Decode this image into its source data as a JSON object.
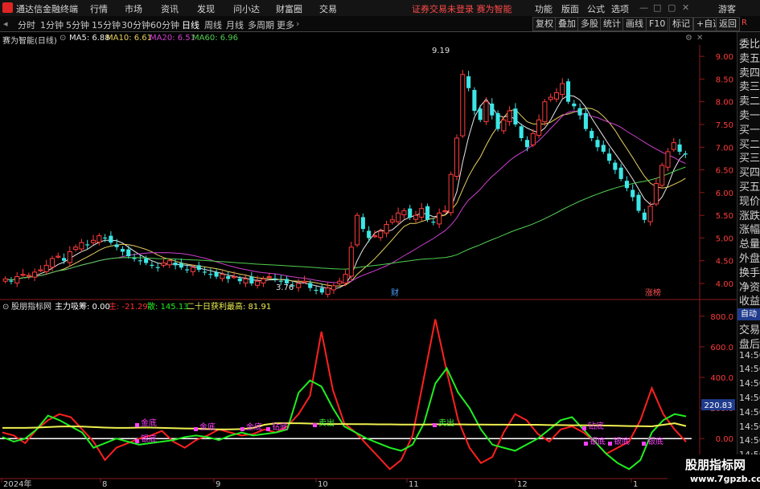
{
  "menubar": {
    "app_title": "通达信金融终端",
    "menus": [
      "行情",
      "市场",
      "资讯",
      "发现",
      "问小达",
      "财富圈",
      "交易"
    ],
    "alert": "证券交易未登录  赛为智能",
    "right": [
      "功能",
      "版面",
      "公式",
      "选项",
      "游客"
    ]
  },
  "periods": [
    "分时",
    "1分钟",
    "5分钟",
    "15分钟",
    "30分钟",
    "60分钟",
    "日线",
    "周线",
    "月线",
    "多周期",
    "更多"
  ],
  "active_period": "日线",
  "toolbar": [
    "复权",
    "叠加",
    "多股",
    "统计",
    "画线",
    "F10",
    "标记",
    "+自选",
    "返回"
  ],
  "main_info": {
    "name": "赛为智能(日线)",
    "ma5": "MA5: 6.88",
    "ma10": "MA10: 6.61",
    "ma20": "MA20: 6.51",
    "ma60": "MA60: 6.96"
  },
  "colors": {
    "bull": "#ff3c3c",
    "bear": "#3ce6e6",
    "ma5": "#e8e8e8",
    "ma10": "#e8d060",
    "ma20": "#d040d0",
    "ma60": "#50d050",
    "osc_red": "#ff2020",
    "osc_green": "#20ee20",
    "osc_yellow": "#f0f050",
    "label_magenta": "#ff40ff"
  },
  "price_axis": {
    "ticks": [
      "9.00",
      "8.50",
      "8.00",
      "7.50",
      "7.00",
      "6.50",
      "6.00",
      "5.50",
      "5.00",
      "4.50",
      "4.00"
    ],
    "values": [
      9.0,
      8.5,
      8.0,
      7.5,
      7.0,
      6.5,
      6.0,
      5.5,
      5.0,
      4.5,
      4.0
    ]
  },
  "candle_annotations": {
    "high": "9.19",
    "low": "3.76"
  },
  "event_markers": [
    "财",
    "涨榜"
  ],
  "sub_info": {
    "name": "股朋指标网",
    "main": "主力吸筹: 0.00",
    "zhu": "主: -21.29",
    "san": "散: 145.13",
    "profit": "二十日获利最高: 81.91"
  },
  "sub_axis": {
    "ticks": [
      "800.0",
      "600.0",
      "400.0",
      "200.0",
      "0.00"
    ],
    "values": [
      800,
      600,
      400,
      200,
      0
    ],
    "current": "220.83"
  },
  "sub_labels": [
    "金底",
    "银底",
    "金底",
    "金底",
    "钻底",
    "卖出",
    "卖出",
    "钻底",
    "银底",
    "银底",
    "银底"
  ],
  "date_axis": [
    "2024年",
    "8",
    "9",
    "10",
    "11",
    "12",
    "1"
  ],
  "right_panel": [
    "委比",
    "卖五",
    "卖四",
    "卖三",
    "卖二",
    "卖一",
    "买一",
    "买二",
    "买三",
    "买四",
    "买五",
    "现价",
    "涨跌",
    "涨幅",
    "总量",
    "外盘",
    "换手",
    "净资",
    "收益",
    "自动",
    "交易",
    "盘后",
    "14:56",
    "14:56",
    "14:56",
    "14:56",
    "14:56",
    "14:56",
    "14:56",
    "14:56"
  ],
  "watermark": {
    "line1": "股朋指标网",
    "line2": "www.7gpzb.com"
  },
  "chart_data": {
    "type": "candlestick",
    "price_range": [
      3.76,
      9.19
    ],
    "shown_high": 9.19,
    "shown_low": 3.76,
    "y_axis_ticks": [
      4.0,
      4.5,
      5.0,
      5.5,
      6.0,
      6.5,
      7.0,
      7.5,
      8.0,
      8.5,
      9.0
    ],
    "series": [
      {
        "name": "MA5",
        "last": 6.88
      },
      {
        "name": "MA10",
        "last": 6.61
      },
      {
        "name": "MA20",
        "last": 6.51
      },
      {
        "name": "MA60",
        "last": 6.96
      }
    ],
    "close": [
      4.1,
      4.05,
      4.15,
      4.2,
      4.18,
      4.25,
      4.3,
      4.4,
      4.55,
      4.6,
      4.5,
      4.7,
      4.8,
      4.9,
      4.85,
      4.95,
      5.05,
      5.0,
      4.9,
      4.8,
      4.7,
      4.6,
      4.55,
      4.5,
      4.45,
      4.4,
      4.35,
      4.45,
      4.5,
      4.4,
      4.35,
      4.3,
      4.35,
      4.3,
      4.25,
      4.2,
      4.15,
      4.2,
      4.1,
      4.15,
      4.05,
      4.1,
      4.0,
      4.05,
      4.1,
      4.15,
      4.1,
      4.05,
      4.0,
      3.95,
      4.0,
      4.05,
      3.9,
      3.85,
      3.8,
      3.9,
      3.95,
      4.05,
      4.2,
      4.8,
      5.5,
      5.2,
      5.0,
      5.05,
      5.15,
      5.3,
      5.4,
      5.55,
      5.6,
      5.45,
      5.5,
      5.65,
      5.4,
      5.35,
      5.55,
      5.6,
      6.4,
      7.2,
      8.6,
      8.3,
      7.8,
      7.6,
      8.0,
      7.7,
      7.4,
      7.6,
      7.8,
      7.5,
      7.2,
      7.0,
      7.3,
      7.6,
      8.0,
      8.1,
      8.2,
      8.4,
      8.0,
      7.9,
      7.7,
      7.4,
      7.2,
      7.0,
      6.9,
      6.7,
      6.5,
      6.3,
      6.1,
      5.9,
      5.6,
      5.4,
      5.7,
      6.2,
      6.6,
      6.9,
      7.1,
      6.9,
      6.85
    ]
  },
  "chart_data_sub": {
    "type": "line",
    "y_axis_ticks": [
      0,
      200,
      400,
      600,
      800
    ],
    "current": 220.83,
    "series": [
      {
        "name": "主",
        "last": -21.29,
        "values": [
          40,
          20,
          -30,
          60,
          120,
          160,
          140,
          60,
          -20,
          -140,
          -60,
          -30,
          0,
          20,
          50,
          -20,
          -60,
          -10,
          20,
          60,
          40,
          20,
          30,
          60,
          40,
          80,
          160,
          280,
          700,
          320,
          100,
          40,
          -40,
          -120,
          -200,
          -140,
          20,
          400,
          780,
          440,
          120,
          -60,
          -160,
          -120,
          40,
          160,
          120,
          30,
          -20,
          60,
          80,
          40,
          -20,
          -100,
          -60,
          -20,
          120,
          330,
          160,
          60,
          -21.29
        ]
      },
      {
        "name": "散",
        "last": 145.13,
        "values": [
          10,
          -20,
          0,
          60,
          150,
          120,
          80,
          40,
          -60,
          -30,
          0,
          -20,
          -40,
          -30,
          -20,
          -10,
          10,
          20,
          10,
          -10,
          20,
          40,
          20,
          30,
          40,
          60,
          300,
          380,
          340,
          200,
          80,
          40,
          0,
          -30,
          -60,
          -80,
          -40,
          100,
          360,
          460,
          300,
          200,
          60,
          -40,
          -60,
          -80,
          -40,
          0,
          60,
          120,
          140,
          60,
          -20,
          -100,
          -160,
          -200,
          -140,
          40,
          120,
          160,
          145.13
        ]
      },
      {
        "name": "二十日获利最高",
        "last": 81.91,
        "values": [
          70,
          70,
          70,
          72,
          75,
          78,
          80,
          78,
          75,
          72,
          70,
          70,
          72,
          72,
          70,
          68,
          66,
          65,
          62,
          60,
          60,
          62,
          70,
          90,
          100,
          100,
          100,
          98,
          96,
          95,
          95,
          94,
          94,
          93,
          93,
          92,
          92,
          92,
          93,
          93,
          93,
          92,
          92,
          91,
          91,
          90,
          90,
          90,
          88,
          88,
          87,
          87,
          86,
          85,
          84,
          82,
          81,
          80,
          90,
          100,
          81.91
        ]
      }
    ]
  }
}
